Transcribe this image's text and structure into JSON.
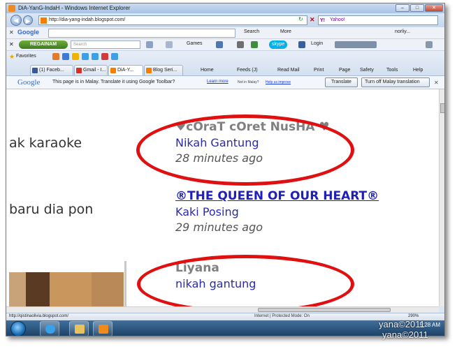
{
  "window": {
    "title": "DiA-YanG-IndaH - Windows Internet Explorer"
  },
  "address_bar": {
    "url": "http://dia-yang-indah.blogspot.com/",
    "search_provider": "Yahoo!"
  },
  "google_toolbar": {
    "logo": "Google",
    "search_label": "Search",
    "more_label": "More",
    "user_label": "norliy..."
  },
  "second_toolbar": {
    "brand": "REGAINAM",
    "search_placeholder": "Search",
    "games_label": "Games",
    "skype_label": "skype",
    "login_label": "Login"
  },
  "favorites_bar": {
    "favorites_label": "Favorites",
    "tabs": [
      {
        "label": "(1) Faceb..."
      },
      {
        "label": "Gmail - I..."
      },
      {
        "label": "DiA-Y..."
      },
      {
        "label": "Blog Seri..."
      }
    ],
    "commands": {
      "home": "Home",
      "feeds": "Feeds (J)",
      "read_mail": "Read Mail",
      "print": "Print",
      "page": "Page",
      "safety": "Safety",
      "tools": "Tools",
      "help": "Help"
    }
  },
  "translate_bar": {
    "logo": "Google",
    "message": "This page is in Malay.  Translate it using Google Toolbar?",
    "learn_more": "Learn more",
    "not_malay": "Not in Malay?",
    "help_improve": "Help us improve",
    "translate_button": "Translate",
    "turn_off_button": "Turn off Malay translation"
  },
  "page": {
    "left_column": [
      {
        "text": "ak karaoke"
      },
      {
        "text": "baru dia pon"
      }
    ],
    "blog_list": [
      {
        "blog_name": "♥cOraT cOret NusHA ♥",
        "post_title": "Nikah Gantung",
        "time_ago": "28 minutes ago"
      },
      {
        "blog_name": "®THE QUEEN OF OUR HEART®",
        "post_title": "Kaki Posing",
        "time_ago": "29 minutes ago"
      },
      {
        "blog_name": "Liyana",
        "post_title": "nikah gantung"
      }
    ]
  },
  "status_bar": {
    "url": "http://qistinaolivia.blogspot.com/",
    "zone": "Internet | Protected Mode: On",
    "zoom": "290%"
  },
  "taskbar": {
    "clock": "5:28 AM"
  },
  "watermark": {
    "line_1": "yana©2011",
    "line_2": "yana©2011"
  },
  "colors": {
    "annotation_circle": "#e01010",
    "blog_name_gray": "#808080",
    "post_link_blue": "#2a2ab0"
  }
}
